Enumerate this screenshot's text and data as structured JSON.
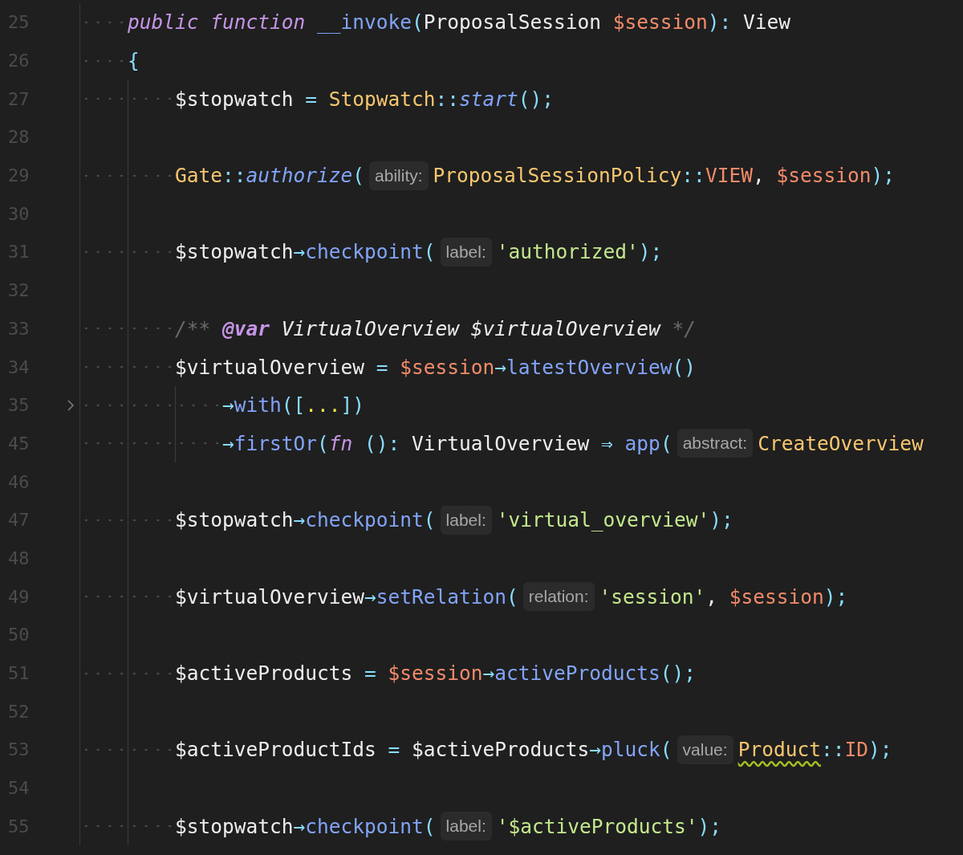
{
  "editor": {
    "lines": [
      {
        "number": "25",
        "kind": "member",
        "folded": false,
        "tokens": [
          {
            "text": "public ",
            "kind": "keyword"
          },
          {
            "text": "function ",
            "kind": "keyword"
          },
          {
            "text": "__invoke",
            "kind": "function"
          },
          {
            "text": "(",
            "kind": "punct"
          },
          {
            "text": "ProposalSession ",
            "kind": "plain"
          },
          {
            "text": "$session",
            "kind": "variable"
          },
          {
            "text": "): ",
            "kind": "punct"
          },
          {
            "text": "View",
            "kind": "plain"
          }
        ]
      },
      {
        "number": "26",
        "kind": "member",
        "folded": false,
        "tokens": [
          {
            "text": "{",
            "kind": "punct"
          }
        ]
      },
      {
        "number": "27",
        "kind": "body",
        "folded": false,
        "tokens": [
          {
            "text": "$stopwatch",
            "kind": "plain"
          },
          {
            "text": " = ",
            "kind": "punct"
          },
          {
            "text": "Stopwatch",
            "kind": "class"
          },
          {
            "text": "::",
            "kind": "punct"
          },
          {
            "text": "start",
            "kind": "static"
          },
          {
            "text": "();",
            "kind": "punct"
          }
        ]
      },
      {
        "number": "28",
        "kind": "blank",
        "folded": false
      },
      {
        "number": "29",
        "kind": "body",
        "folded": false,
        "tokens": [
          {
            "text": "Gate",
            "kind": "class"
          },
          {
            "text": "::",
            "kind": "punct"
          },
          {
            "text": "authorize",
            "kind": "static"
          },
          {
            "text": "(",
            "kind": "punct"
          },
          {
            "text": "ability:",
            "kind": "hint"
          },
          {
            "text": "ProposalSessionPolicy",
            "kind": "class"
          },
          {
            "text": "::",
            "kind": "punct"
          },
          {
            "text": "VIEW",
            "kind": "constant"
          },
          {
            "text": ", ",
            "kind": "plain"
          },
          {
            "text": "$session",
            "kind": "variable"
          },
          {
            "text": ");",
            "kind": "punct"
          }
        ]
      },
      {
        "number": "30",
        "kind": "blank",
        "folded": false
      },
      {
        "number": "31",
        "kind": "body",
        "folded": false,
        "tokens": [
          {
            "text": "$stopwatch",
            "kind": "plain"
          },
          {
            "text": "→",
            "kind": "punct"
          },
          {
            "text": "checkpoint",
            "kind": "function"
          },
          {
            "text": "(",
            "kind": "punct"
          },
          {
            "text": "label:",
            "kind": "hint"
          },
          {
            "text": "'authorized'",
            "kind": "string"
          },
          {
            "text": ");",
            "kind": "punct"
          }
        ]
      },
      {
        "number": "32",
        "kind": "blank",
        "folded": false
      },
      {
        "number": "33",
        "kind": "body",
        "folded": false,
        "tokens": [
          {
            "text": "/** ",
            "kind": "comment"
          },
          {
            "text": "@var",
            "kind": "doctag"
          },
          {
            "text": " VirtualOverview $virtualOverview ",
            "kind": "doctype"
          },
          {
            "text": "*/",
            "kind": "comment"
          }
        ]
      },
      {
        "number": "34",
        "kind": "body",
        "folded": false,
        "tokens": [
          {
            "text": "$virtualOverview",
            "kind": "plain"
          },
          {
            "text": " = ",
            "kind": "punct"
          },
          {
            "text": "$session",
            "kind": "variable"
          },
          {
            "text": "→",
            "kind": "punct"
          },
          {
            "text": "latestOverview",
            "kind": "function"
          },
          {
            "text": "()",
            "kind": "punct"
          }
        ]
      },
      {
        "number": "35",
        "kind": "chain",
        "folded": true,
        "tokens": [
          {
            "text": "→",
            "kind": "punct"
          },
          {
            "text": "with",
            "kind": "function"
          },
          {
            "text": "([",
            "kind": "punct"
          },
          {
            "text": "...",
            "kind": "ellipsis"
          },
          {
            "text": "])",
            "kind": "punct"
          }
        ]
      },
      {
        "number": "45",
        "kind": "chain",
        "folded": false,
        "tokens": [
          {
            "text": "→",
            "kind": "punct"
          },
          {
            "text": "firstOr",
            "kind": "function"
          },
          {
            "text": "(",
            "kind": "punct"
          },
          {
            "text": "fn",
            "kind": "keyword"
          },
          {
            "text": " (): ",
            "kind": "punct"
          },
          {
            "text": "VirtualOverview",
            "kind": "plain"
          },
          {
            "text": " ⇒ ",
            "kind": "punct"
          },
          {
            "text": "app",
            "kind": "function"
          },
          {
            "text": "(",
            "kind": "punct"
          },
          {
            "text": "abstract:",
            "kind": "hint"
          },
          {
            "text": "CreateOverview",
            "kind": "class"
          }
        ]
      },
      {
        "number": "46",
        "kind": "blank",
        "folded": false
      },
      {
        "number": "47",
        "kind": "body",
        "folded": false,
        "tokens": [
          {
            "text": "$stopwatch",
            "kind": "plain"
          },
          {
            "text": "→",
            "kind": "punct"
          },
          {
            "text": "checkpoint",
            "kind": "function"
          },
          {
            "text": "(",
            "kind": "punct"
          },
          {
            "text": "label:",
            "kind": "hint"
          },
          {
            "text": "'virtual_overview'",
            "kind": "string"
          },
          {
            "text": ");",
            "kind": "punct"
          }
        ]
      },
      {
        "number": "48",
        "kind": "blank",
        "folded": false
      },
      {
        "number": "49",
        "kind": "body",
        "folded": false,
        "tokens": [
          {
            "text": "$virtualOverview",
            "kind": "plain"
          },
          {
            "text": "→",
            "kind": "punct"
          },
          {
            "text": "setRelation",
            "kind": "function"
          },
          {
            "text": "(",
            "kind": "punct"
          },
          {
            "text": "relation:",
            "kind": "hint"
          },
          {
            "text": "'session'",
            "kind": "string"
          },
          {
            "text": ", ",
            "kind": "plain"
          },
          {
            "text": "$session",
            "kind": "variable"
          },
          {
            "text": ");",
            "kind": "punct"
          }
        ]
      },
      {
        "number": "50",
        "kind": "blank",
        "folded": false
      },
      {
        "number": "51",
        "kind": "body",
        "folded": false,
        "tokens": [
          {
            "text": "$activeProducts",
            "kind": "plain"
          },
          {
            "text": " = ",
            "kind": "punct"
          },
          {
            "text": "$session",
            "kind": "variable"
          },
          {
            "text": "→",
            "kind": "punct"
          },
          {
            "text": "activeProducts",
            "kind": "function"
          },
          {
            "text": "();",
            "kind": "punct"
          }
        ]
      },
      {
        "number": "52",
        "kind": "blank",
        "folded": false
      },
      {
        "number": "53",
        "kind": "body",
        "folded": false,
        "tokens": [
          {
            "text": "$activeProductIds",
            "kind": "plain"
          },
          {
            "text": " = ",
            "kind": "punct"
          },
          {
            "text": "$activeProducts",
            "kind": "plain"
          },
          {
            "text": "→",
            "kind": "punct"
          },
          {
            "text": "pluck",
            "kind": "function"
          },
          {
            "text": "(",
            "kind": "punct"
          },
          {
            "text": "value:",
            "kind": "hint"
          },
          {
            "text": "Product",
            "kind": "class",
            "warning": true
          },
          {
            "text": "::",
            "kind": "punct"
          },
          {
            "text": "ID",
            "kind": "constant"
          },
          {
            "text": ");",
            "kind": "punct"
          }
        ]
      },
      {
        "number": "54",
        "kind": "blank",
        "folded": false
      },
      {
        "number": "55",
        "kind": "body",
        "folded": false,
        "tokens": [
          {
            "text": "$stopwatch",
            "kind": "plain"
          },
          {
            "text": "→",
            "kind": "punct"
          },
          {
            "text": "checkpoint",
            "kind": "function"
          },
          {
            "text": "(",
            "kind": "punct"
          },
          {
            "text": "label:",
            "kind": "hint"
          },
          {
            "text": "'$activeProducts'",
            "kind": "string"
          },
          {
            "text": ");",
            "kind": "punct"
          }
        ]
      }
    ]
  }
}
